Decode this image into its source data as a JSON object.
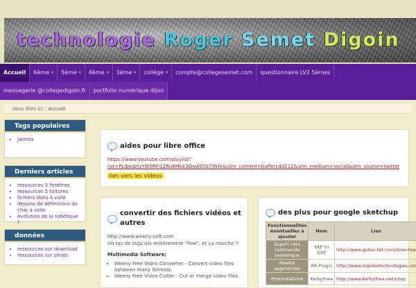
{
  "banner": {
    "title_words": [
      "technologie",
      "Roger",
      "Semet",
      "Digoin"
    ]
  },
  "nav": {
    "row1": [
      {
        "label": "Accueil",
        "active": true,
        "caret": false
      },
      {
        "label": "6ème",
        "caret": true
      },
      {
        "label": "5ème",
        "caret": true
      },
      {
        "label": "4ème",
        "caret": true
      },
      {
        "label": "3ème",
        "caret": true
      },
      {
        "label": "collège",
        "caret": true
      },
      {
        "label": "compte@collegesemet.com",
        "caret": false
      },
      {
        "label": "questionnaire LV2 5èmes",
        "caret": false
      }
    ],
    "row2": [
      {
        "label": "messagerie @collegedigoin.fr"
      },
      {
        "label": "portfolio numérique dijon"
      }
    ]
  },
  "breadcrumb": {
    "prefix": "Vous êtes ici :",
    "current": "Accueil"
  },
  "sidebar": {
    "boxes": [
      {
        "title": "Tags populaires",
        "items": [
          "Joomla"
        ]
      },
      {
        "title": "Derniers articles",
        "items": [
          "ressources 5 fenêtres",
          "ressources 5 toitures",
          "fichiers dans à voile",
          "dessins de définitions du char à voile",
          "évolution de la robotique ?"
        ]
      },
      {
        "title": "données",
        "items": [
          "ressources sur download",
          "ressources sur photo"
        ]
      }
    ]
  },
  "panel1": {
    "title": "aides pour libre office",
    "url_line1": "https://www.youtube.com/playlist?",
    "url_line2": "list=PLlbodzlyYW0RFi1ZRu8MkE3OxWOSt7Xktk&utm_content=buffercdd212&utm_medium=social&utm_source=twitter",
    "video_link": "lien vers les vidéos"
  },
  "panel2": {
    "title": "convertir des fichiers vidéos et autres",
    "line1": "http://www.weeny-soft.com",
    "line2": "Un tas de logiciels entièrement \"free\", et ça marche !!",
    "multimedia_heading": "Multimedia Software:",
    "items": [
      "Weeny Free Video Converter - Convert video files between many formats.",
      "Weeny Free Video Cutter - Cut or merge video files."
    ]
  },
  "panel3": {
    "title": "des plus pour google sketchup",
    "headers": [
      "Fonctionnalités éventuelles à ajouter",
      "Nom",
      "Lien"
    ],
    "rows": [
      {
        "feature": "Export vers commande numérique",
        "name": "SKP to DXF",
        "link": "http://www.guitar-list.com/download-software/convert-sketchup-skp-files-dxf"
      },
      {
        "feature": "Réalité augmentée",
        "name": "AR-Plugin",
        "link": "http://www.inglobetechnologies.com/en/new_products/arplugin_su/info.php"
      },
      {
        "feature": "Photoréalisme",
        "name": "Kerkythea",
        "link": "http://www.kerkythea.net/cms/"
      }
    ]
  }
}
